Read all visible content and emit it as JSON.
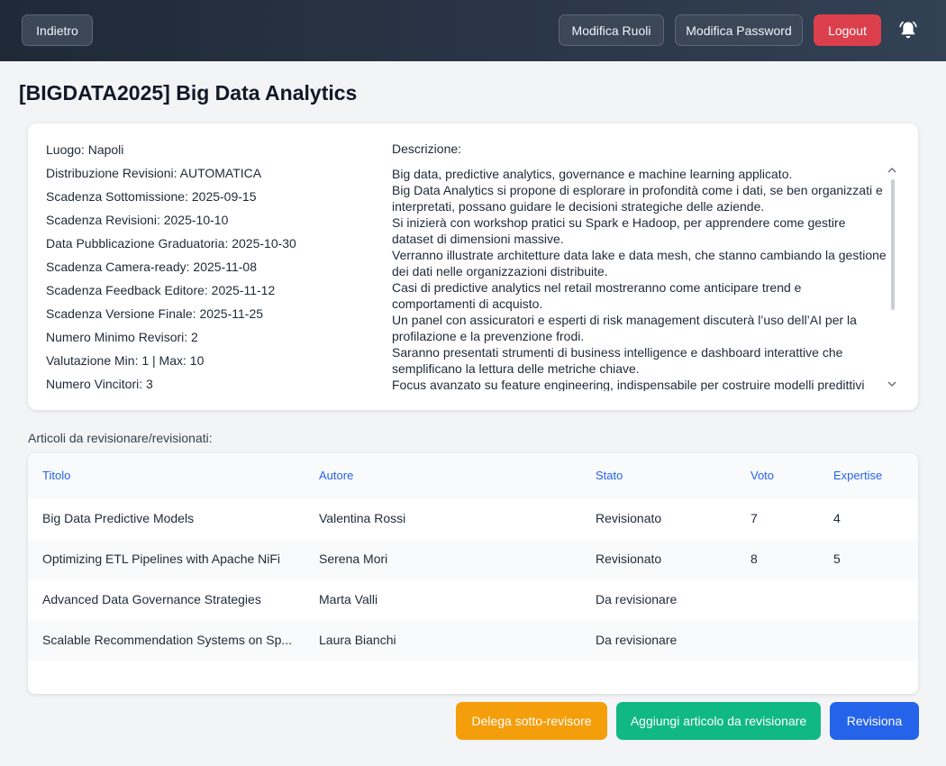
{
  "header": {
    "back_label": "Indietro",
    "roles_label": "Modifica Ruoli",
    "password_label": "Modifica Password",
    "logout_label": "Logout",
    "notification_icon": "bell-icon"
  },
  "page": {
    "title": "[BIGDATA2025] Big Data Analytics"
  },
  "conference_info": {
    "items": [
      "Luogo: Napoli",
      "Distribuzione Revisioni: AUTOMATICA",
      "Scadenza Sottomissione: 2025-09-15",
      "Scadenza Revisioni: 2025-10-10",
      "Data Pubblicazione Graduatoria: 2025-10-30",
      "Scadenza Camera-ready: 2025-11-08",
      "Scadenza Feedback Editore: 2025-11-12",
      "Scadenza Versione Finale: 2025-11-25",
      "Numero Minimo Revisori: 2",
      "Valutazione Min: 1 | Max: 10",
      "Numero Vincitori: 3"
    ],
    "description_label": "Descrizione:",
    "description_lines": [
      "Big data, predictive analytics, governance e machine learning applicato.",
      "Big Data Analytics si propone di esplorare in profondità come i dati, se ben organizzati e interpretati, possano guidare le decisioni strategiche delle aziende.",
      "Si inizierà con workshop pratici su Spark e Hadoop, per apprendere come gestire dataset di dimensioni massive.",
      "Verranno illustrate architetture data lake e data mesh, che stanno cambiando la gestione dei dati nelle organizzazioni distribuite.",
      "Casi di predictive analytics nel retail mostreranno come anticipare trend e comportamenti di acquisto.",
      "Un panel con assicuratori e esperti di risk management discuterà l’uso dell’AI per la profilazione e la prevenzione frodi.",
      "Saranno presentati strumenti di business intelligence e dashboard interattive che semplificano la lettura delle metriche chiave.",
      "Focus avanzato su feature engineering, indispensabile per costruire modelli predittivi"
    ]
  },
  "articles": {
    "section_label": "Articoli da revisionare/revisionati:",
    "columns": [
      "Titolo",
      "Autore",
      "Stato",
      "Voto",
      "Expertise"
    ],
    "rows": [
      {
        "title": "Big Data Predictive Models",
        "author": "Valentina Rossi",
        "status": "Revisionato",
        "vote": "7",
        "expertise": "4"
      },
      {
        "title": "Optimizing ETL Pipelines with Apache NiFi",
        "author": "Serena Mori",
        "status": "Revisionato",
        "vote": "8",
        "expertise": "5"
      },
      {
        "title": "Advanced Data Governance Strategies",
        "author": "Marta Valli",
        "status": "Da revisionare",
        "vote": "",
        "expertise": ""
      },
      {
        "title": "Scalable Recommendation Systems on Sp...",
        "author": "Laura Bianchi",
        "status": "Da revisionare",
        "vote": "",
        "expertise": ""
      }
    ]
  },
  "actions": {
    "delegate_label": "Delega sotto-revisore",
    "add_article_label": "Aggiungi articolo da revisionare",
    "review_label": "Revisiona"
  },
  "colors": {
    "header_bg": "#1f2937",
    "logout": "#dc3f4c",
    "delegate": "#f59e0b",
    "add": "#10b981",
    "review": "#2563eb",
    "table_header_text": "#2563eb"
  }
}
